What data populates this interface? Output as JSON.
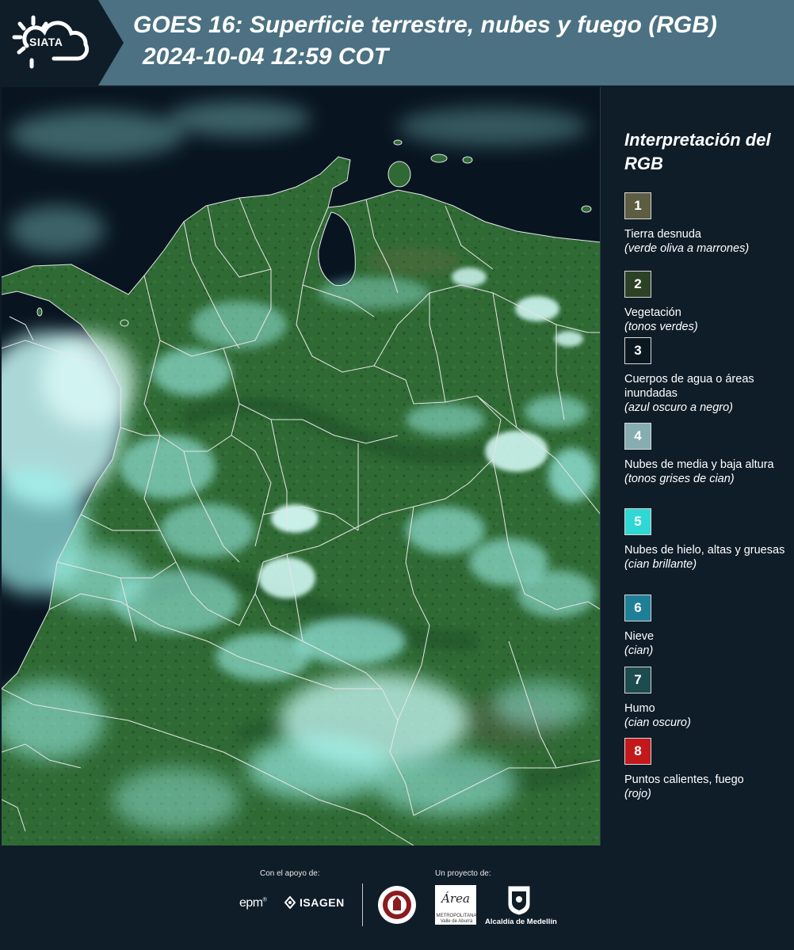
{
  "header": {
    "logo_text": "SIATA",
    "title": "GOES 16: Superficie terrestre, nubes y fuego (RGB)",
    "subtitle": "2024-10-04 12:59 COT"
  },
  "map": {
    "colors": {
      "ocean": "#081521",
      "land": "#2f6a34",
      "land_dark": "#1f4c27",
      "cloud": "#9ff3ee",
      "cloud_bright": "#d9fffc",
      "border": "#e6e6e6"
    }
  },
  "legend": {
    "title": "Interpretación del RGB",
    "items": [
      {
        "number": "1",
        "label": "Tierra desnuda",
        "desc": "(verde oliva a marrones)",
        "color": "#5e5c41"
      },
      {
        "number": "2",
        "label": "Vegetación",
        "desc": "(tonos verdes)",
        "color": "#2c4226"
      },
      {
        "number": "3",
        "label": "Cuerpos de agua o áreas inundadas",
        "desc": "(azul oscuro a negro)",
        "color": "#0c1820"
      },
      {
        "number": "4",
        "label": "Nubes de media y baja altura",
        "desc": "(tonos grises de cian)",
        "color": "#86aeb0"
      },
      {
        "number": "5",
        "label": "Nubes de hielo, altas y gruesas",
        "desc": "(cian brillante)",
        "color": "#2ed8d4"
      },
      {
        "number": "6",
        "label": "Nieve",
        "desc": "(cian)",
        "color": "#1e7f97"
      },
      {
        "number": "7",
        "label": "Humo",
        "desc": "(cian oscuro)",
        "color": "#1d4c50"
      },
      {
        "number": "8",
        "label": "Puntos calientes, fuego",
        "desc": "(rojo)",
        "color": "#c3191c"
      }
    ]
  },
  "footer": {
    "support_label": "Con el apoyo de:",
    "project_label": "Un proyecto de:",
    "epm_logo": "epm",
    "isagen_logo": "ISAGEN",
    "amva_logo": "Área",
    "amva_small": "METROPOLITANA Valle de Aburrá",
    "alcaldia_logo": "Alcaldía de Medellín"
  }
}
